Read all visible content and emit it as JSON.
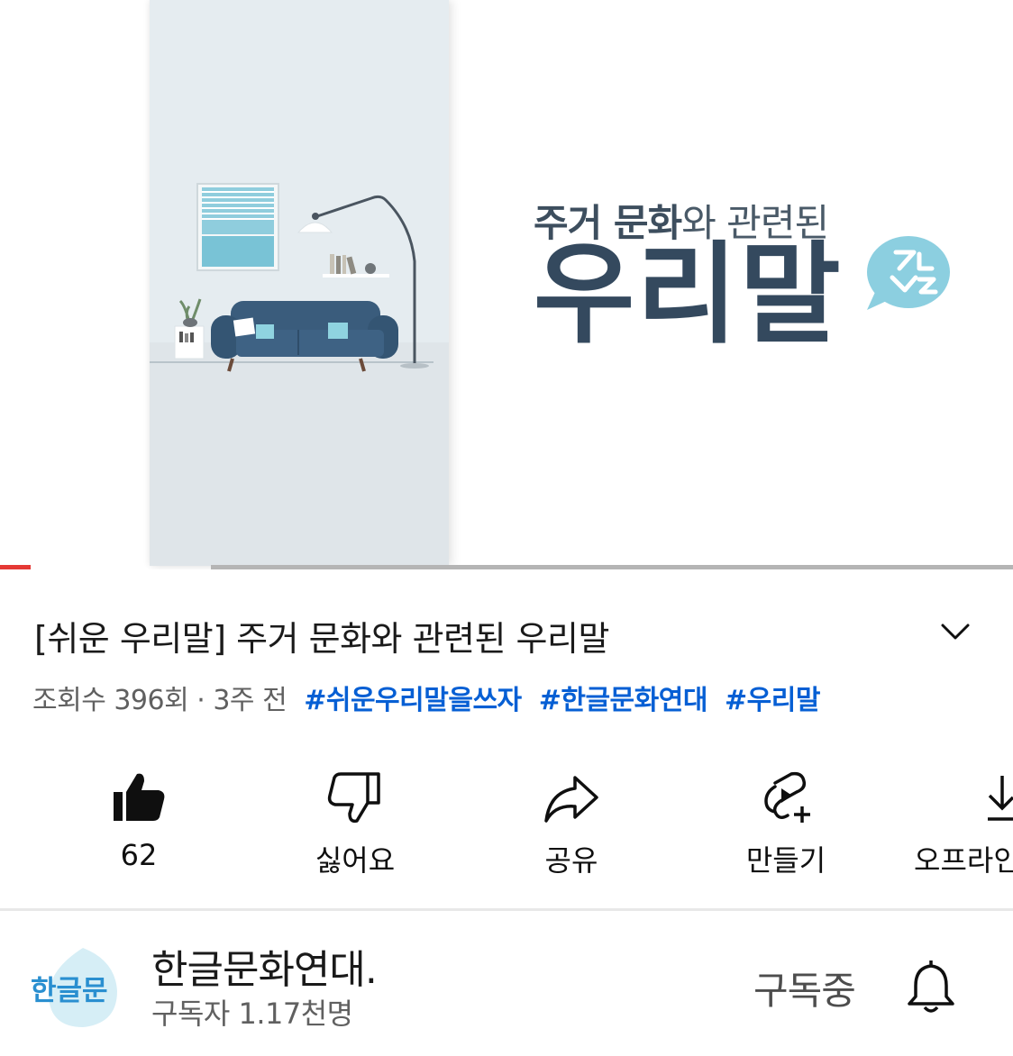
{
  "player": {
    "thumbnail_heading": "주거 문화",
    "thumbnail_heading_rest": "와 관련된",
    "thumbnail_big": "우리말",
    "progress_played": 0.03,
    "colors": {
      "played": "#e53935",
      "track": "#b5b5b5",
      "accent": "#34495e"
    }
  },
  "video": {
    "title": "[쉬운 우리말] 주거 문화와 관련된 우리말",
    "views": "조회수 396회",
    "separator": "·",
    "age": "3주 전",
    "hashtags": [
      "#쉬운우리말을쓰자",
      "#한글문화연대",
      "#우리말"
    ],
    "hashtag_color": "#065fd4"
  },
  "actions": {
    "like": {
      "label": "62",
      "icon": "thumbs-up-icon"
    },
    "dislike": {
      "label": "싫어요",
      "icon": "thumbs-down-icon"
    },
    "share": {
      "label": "공유",
      "icon": "share-icon"
    },
    "remix": {
      "label": "만들기",
      "icon": "remix-icon"
    },
    "offline": {
      "label": "오프라인",
      "icon": "download-icon"
    }
  },
  "channel": {
    "avatar_text": "한글문",
    "name": "한글문화연대.",
    "subscribers": "구독자 1.17천명",
    "subscribe_status": "구독중",
    "bell_icon": "bell-icon"
  }
}
